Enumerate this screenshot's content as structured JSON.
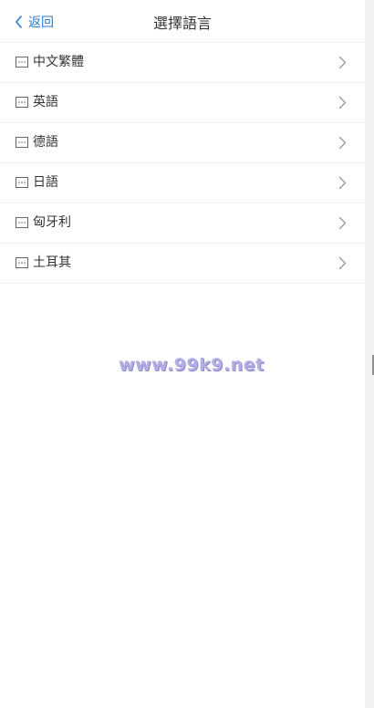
{
  "header": {
    "back_label": "返回",
    "title": "選擇語言"
  },
  "languages": [
    {
      "label": "中文繁體"
    },
    {
      "label": "英語"
    },
    {
      "label": "德語"
    },
    {
      "label": "日語"
    },
    {
      "label": "匈牙利"
    },
    {
      "label": "土耳其"
    }
  ],
  "watermark": "www.99k9.net",
  "colors": {
    "accent": "#2a7bd6",
    "text": "#333333",
    "divider": "#f0f0f0",
    "chevron": "#9a9a9a",
    "watermark": "#b3aee4"
  }
}
